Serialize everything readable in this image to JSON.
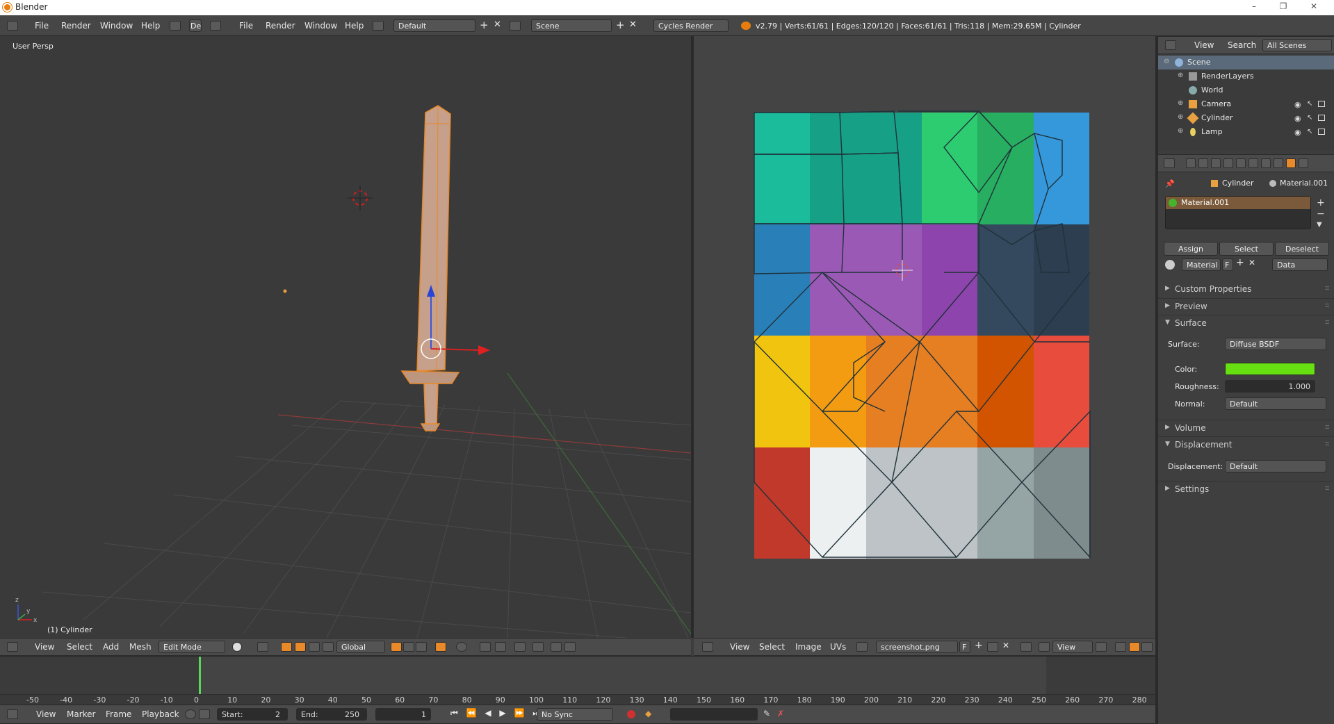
{
  "window": {
    "title": "Blender",
    "controls": [
      "–",
      "❐",
      "✕"
    ]
  },
  "info": {
    "menus": [
      "File",
      "Render",
      "Window",
      "Help"
    ],
    "menus2": [
      "File",
      "Render",
      "Window",
      "Help"
    ],
    "layout_short": "De",
    "layout": "Default",
    "scene": "Scene",
    "engine": "Cycles Render",
    "stats": "v2.79 | Verts:61/61 | Edges:120/120 | Faces:61/61 | Tris:118 | Mem:29.65M | Cylinder"
  },
  "viewport": {
    "view_label": "User Persp",
    "object_label": "(1) Cylinder",
    "axis_x": "x",
    "axis_y": "y",
    "axis_z": "z"
  },
  "view3d_header": {
    "menus": [
      "View",
      "Select",
      "Add",
      "Mesh"
    ],
    "mode": "Edit Mode",
    "orientation": "Global"
  },
  "uv_header": {
    "menus": [
      "View",
      "Select",
      "Image",
      "UVs"
    ],
    "image": "screenshot.png",
    "image_flag": "F",
    "view": "View"
  },
  "outliner": {
    "menus": [
      "View",
      "Search"
    ],
    "filter": "All Scenes",
    "items": [
      {
        "name": "Scene",
        "level": 0,
        "color": "#8fb3d9"
      },
      {
        "name": "RenderLayers",
        "level": 1,
        "color": "#cfcfcf"
      },
      {
        "name": "World",
        "level": 1,
        "color": "#9ab"
      },
      {
        "name": "Camera",
        "level": 1,
        "color": "#e8a040"
      },
      {
        "name": "Cylinder",
        "level": 1,
        "color": "#e8a040"
      },
      {
        "name": "Lamp",
        "level": 1,
        "color": "#e8d060"
      }
    ]
  },
  "properties": {
    "object": "Cylinder",
    "material_slot": "Material.001",
    "material_name": "Material.001",
    "buttons": [
      "Assign",
      "Select",
      "Deselect"
    ],
    "datablock": "Material",
    "datablock_flag": "F",
    "link": "Data",
    "panels": {
      "custom_properties": "Custom Properties",
      "preview": "Preview",
      "surface": "Surface",
      "volume": "Volume",
      "displacement": "Displacement",
      "settings": "Settings"
    },
    "surface_label": "Surface:",
    "surface_value": "Diffuse BSDF",
    "color_label": "Color:",
    "color_value": "#66e010",
    "roughness_label": "Roughness:",
    "roughness_value": "1.000",
    "normal_label": "Normal:",
    "normal_value": "Default",
    "displacement_label": "Displacement:",
    "displacement_value": "Default"
  },
  "timeline": {
    "ticks": [
      "-50",
      "-40",
      "-30",
      "-20",
      "-10",
      "0",
      "10",
      "20",
      "30",
      "40",
      "50",
      "60",
      "70",
      "80",
      "90",
      "100",
      "110",
      "120",
      "130",
      "140",
      "150",
      "160",
      "170",
      "180",
      "190",
      "200",
      "210",
      "220",
      "230",
      "240",
      "250",
      "260",
      "270",
      "280"
    ],
    "menus": [
      "View",
      "Marker",
      "Frame",
      "Playback"
    ],
    "start_label": "Start:",
    "start": "2",
    "end_label": "End:",
    "end": "250",
    "current": "1",
    "sync": "No Sync"
  },
  "palette": {
    "grid": [
      [
        "#1abc9c",
        "#16a085",
        "#16a085",
        "#2ecc71",
        "#27ae60",
        "#3498db"
      ],
      [
        "#2980b9",
        "#9b59b6",
        "#9b59b6",
        "#8e44ad",
        "#34495e",
        "#2c3e50"
      ],
      [
        "#f1c40f",
        "#f39c12",
        "#e67e22",
        "#e67e22",
        "#d35400",
        "#e74c3c"
      ],
      [
        "#c0392b",
        "#ecf0f1",
        "#bdc3c7",
        "#bdc3c7",
        "#95a5a6",
        "#7f8c8d"
      ]
    ],
    "accent": "#e88a2a"
  }
}
